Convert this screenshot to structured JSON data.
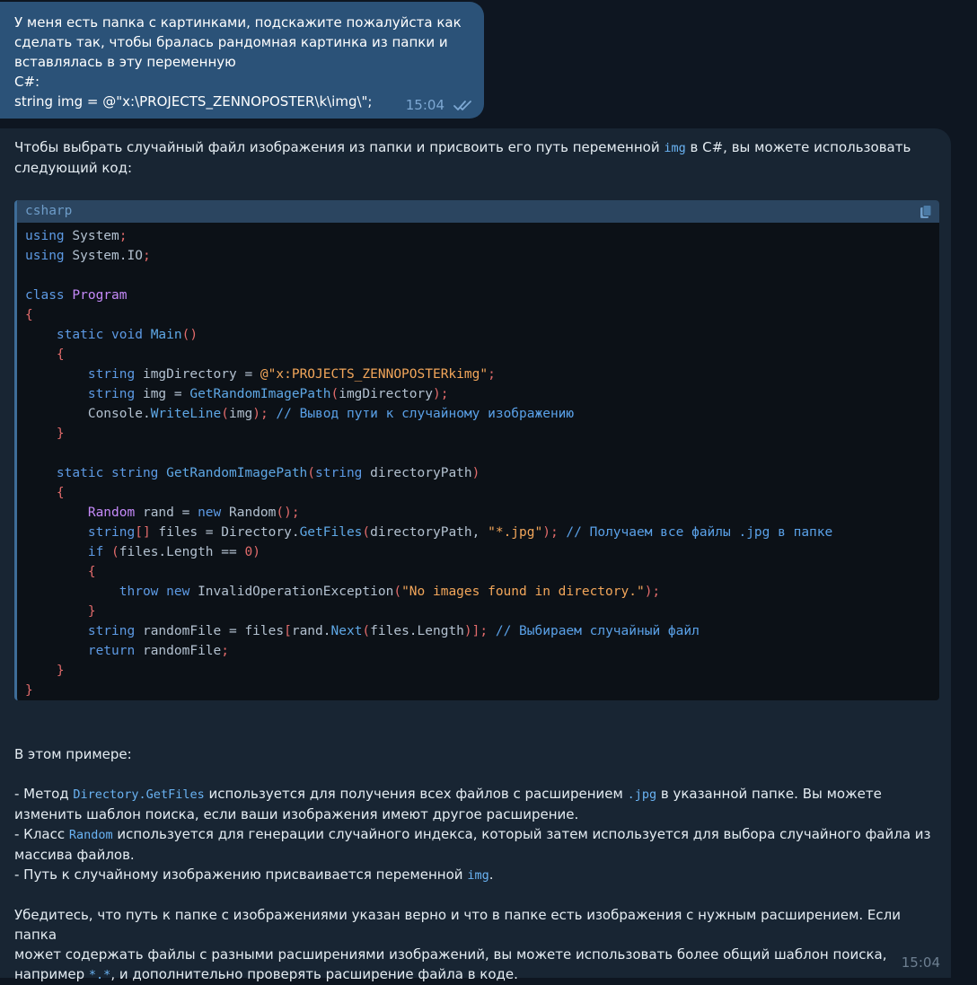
{
  "outgoing": {
    "lines": [
      "У меня есть папка с картинками, подскажите пожалуйста как",
      "сделать так, чтобы бралась рандомная картинка из папки и",
      "вставлялась в эту переменную",
      "C#:",
      "string img = @\"x:\\PROJECTS_ZENNOPOSTER\\k\\img\\\";"
    ],
    "time": "15:04",
    "read_icon": "double-check-icon"
  },
  "incoming": {
    "intro_1": "Чтобы выбрать случайный файл изображения из папки и присвоить его путь переменной ",
    "intro_code": "img",
    "intro_2": " в C#, вы можете использовать",
    "intro_3": "следующий код:",
    "code": {
      "language": "csharp",
      "copy_icon": "copy-icon",
      "lines": [
        [
          [
            "kw",
            "using"
          ],
          [
            "txt",
            " System"
          ],
          [
            "par",
            ";"
          ]
        ],
        [
          [
            "kw",
            "using"
          ],
          [
            "txt",
            " System.IO"
          ],
          [
            "par",
            ";"
          ]
        ],
        [],
        [
          [
            "kw",
            "class"
          ],
          [
            "txt",
            " "
          ],
          [
            "cls",
            "Program"
          ]
        ],
        [
          [
            "br",
            "{"
          ]
        ],
        [
          [
            "txt",
            "    "
          ],
          [
            "kw",
            "static void"
          ],
          [
            "txt",
            " "
          ],
          [
            "fn",
            "Main"
          ],
          [
            "br",
            "()"
          ]
        ],
        [
          [
            "txt",
            "    "
          ],
          [
            "br",
            "{"
          ]
        ],
        [
          [
            "txt",
            "        "
          ],
          [
            "kw",
            "string"
          ],
          [
            "txt",
            " imgDirectory = "
          ],
          [
            "str",
            "@\"x:PROJECTS_ZENNOPOSTERkimg\""
          ],
          [
            "par",
            ";"
          ]
        ],
        [
          [
            "txt",
            "        "
          ],
          [
            "kw",
            "string"
          ],
          [
            "txt",
            " img = "
          ],
          [
            "fn",
            "GetRandomImagePath"
          ],
          [
            "br",
            "("
          ],
          [
            "txt",
            "imgDirectory"
          ],
          [
            "br",
            ")"
          ],
          [
            "par",
            ";"
          ]
        ],
        [
          [
            "txt",
            "        Console."
          ],
          [
            "fn",
            "WriteLine"
          ],
          [
            "br",
            "("
          ],
          [
            "txt",
            "img"
          ],
          [
            "br",
            ")"
          ],
          [
            "par",
            ";"
          ],
          [
            "txt",
            " "
          ],
          [
            "cm",
            "// Вывод пути к случайному изображению"
          ]
        ],
        [
          [
            "txt",
            "    "
          ],
          [
            "br",
            "}"
          ]
        ],
        [],
        [
          [
            "txt",
            "    "
          ],
          [
            "kw",
            "static string"
          ],
          [
            "txt",
            " "
          ],
          [
            "fn",
            "GetRandomImagePath"
          ],
          [
            "br",
            "("
          ],
          [
            "kw",
            "string"
          ],
          [
            "txt",
            " directoryPath"
          ],
          [
            "br",
            ")"
          ]
        ],
        [
          [
            "txt",
            "    "
          ],
          [
            "br",
            "{"
          ]
        ],
        [
          [
            "txt",
            "        "
          ],
          [
            "cls",
            "Random"
          ],
          [
            "txt",
            " rand = "
          ],
          [
            "kw",
            "new"
          ],
          [
            "txt",
            " Random"
          ],
          [
            "br",
            "()"
          ],
          [
            "par",
            ";"
          ]
        ],
        [
          [
            "txt",
            "        "
          ],
          [
            "kw",
            "string"
          ],
          [
            "br",
            "[]"
          ],
          [
            "txt",
            " files = Directory."
          ],
          [
            "fn",
            "GetFiles"
          ],
          [
            "br",
            "("
          ],
          [
            "txt",
            "directoryPath, "
          ],
          [
            "str",
            "\"*.jpg\""
          ],
          [
            "br",
            ")"
          ],
          [
            "par",
            ";"
          ],
          [
            "txt",
            " "
          ],
          [
            "cm",
            "// Получаем все файлы .jpg в папке"
          ]
        ],
        [
          [
            "txt",
            "        "
          ],
          [
            "kw",
            "if"
          ],
          [
            "txt",
            " "
          ],
          [
            "br",
            "("
          ],
          [
            "txt",
            "files.Length == "
          ],
          [
            "br",
            "0)"
          ]
        ],
        [
          [
            "txt",
            "        "
          ],
          [
            "br",
            "{"
          ]
        ],
        [
          [
            "txt",
            "            "
          ],
          [
            "kw",
            "throw new"
          ],
          [
            "txt",
            " InvalidOperationException"
          ],
          [
            "br",
            "("
          ],
          [
            "str",
            "\"No images found in directory.\""
          ],
          [
            "br",
            ")"
          ],
          [
            "par",
            ";"
          ]
        ],
        [
          [
            "txt",
            "        "
          ],
          [
            "br",
            "}"
          ]
        ],
        [
          [
            "txt",
            "        "
          ],
          [
            "kw",
            "string"
          ],
          [
            "txt",
            " randomFile = files"
          ],
          [
            "br",
            "["
          ],
          [
            "txt",
            "rand."
          ],
          [
            "fn",
            "Next"
          ],
          [
            "br",
            "("
          ],
          [
            "txt",
            "files.Length"
          ],
          [
            "br",
            ")]"
          ],
          [
            "par",
            ";"
          ],
          [
            "txt",
            " "
          ],
          [
            "cm",
            "// Выбираем случайный файл"
          ]
        ],
        [
          [
            "txt",
            "        "
          ],
          [
            "kw",
            "return"
          ],
          [
            "txt",
            " randomFile"
          ],
          [
            "par",
            ";"
          ]
        ],
        [
          [
            "txt",
            "    "
          ],
          [
            "br",
            "}"
          ]
        ],
        [
          [
            "br",
            "}"
          ]
        ]
      ]
    },
    "explain_title": "В этом примере:",
    "bullet1_a": "- Метод ",
    "bullet1_code": "Directory.GetFiles",
    "bullet1_b": " используется для получения всех файлов с расширением ",
    "bullet1_code2": ".jpg",
    "bullet1_c": " в указанной папке. Вы можете",
    "bullet1_d": "изменить шаблон поиска, если ваши изображения имеют другое расширение.",
    "bullet2_a": "- Класс ",
    "bullet2_code": "Random",
    "bullet2_b": " используется для генерации случайного индекса, который затем используется для выбора случайного файла из",
    "bullet2_c": "массива файлов.",
    "bullet3_a": "- Путь к случайному изображению присваивается переменной ",
    "bullet3_code": "img",
    "bullet3_b": ".",
    "final_1": "Убедитесь, что путь к папке с изображениями указан верно и что в папке есть изображения с нужным расширением. Если папка",
    "final_2": "может содержать файлы с разными расширениями изображений, вы можете использовать более общий шаблон поиска,",
    "final_3a": "например ",
    "final_3code": "*.*",
    "final_3b": ", и дополнительно проверять расширение файла в коде.",
    "time": "15:04"
  }
}
